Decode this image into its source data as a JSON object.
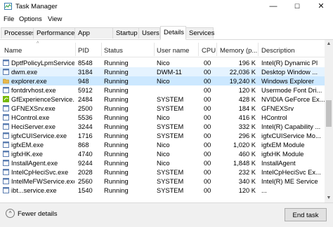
{
  "window": {
    "title": "Task Manager",
    "controls": {
      "minimize": "—",
      "maximize": "☐",
      "close": "✕"
    }
  },
  "menu": [
    "File",
    "Options",
    "View"
  ],
  "tabs": [
    "Processes",
    "Performance",
    "App history",
    "Startup",
    "Users",
    "Details",
    "Services"
  ],
  "active_tab": "Details",
  "columns": {
    "name": "Name",
    "pid": "PID",
    "status": "Status",
    "user": "User name",
    "cpu": "CPU",
    "memory": "Memory (p...",
    "description": "Description"
  },
  "rows": [
    {
      "name": "DptfPolicyLpmService...",
      "pid": "8548",
      "status": "Running",
      "user": "Nico",
      "cpu": "00",
      "memory": "196 K",
      "description": "Intel(R) Dynamic Pl",
      "icon": "app-icon",
      "color": "#5b7db1"
    },
    {
      "name": "dwm.exe",
      "pid": "3184",
      "status": "Running",
      "user": "DWM-11",
      "cpu": "00",
      "memory": "22,036 K",
      "description": "Desktop Window ...",
      "icon": "app-icon",
      "color": "#5b7db1"
    },
    {
      "name": "explorer.exe",
      "pid": "948",
      "status": "Running",
      "user": "Nico",
      "cpu": "00",
      "memory": "19,240 K",
      "description": "Windows Explorer",
      "icon": "folder-icon",
      "color": "#e8b84a"
    },
    {
      "name": "fontdrvhost.exe",
      "pid": "5912",
      "status": "Running",
      "user": "",
      "cpu": "00",
      "memory": "120 K",
      "description": "Usermode Font Dri...",
      "icon": "app-icon",
      "color": "#5b7db1"
    },
    {
      "name": "GfExperienceService....",
      "pid": "2484",
      "status": "Running",
      "user": "SYSTEM",
      "cpu": "00",
      "memory": "428 K",
      "description": "NVIDIA GeForce Ex...",
      "icon": "nvidia-icon",
      "color": "#76b900"
    },
    {
      "name": "GFNEXSrv.exe",
      "pid": "2500",
      "status": "Running",
      "user": "SYSTEM",
      "cpu": "00",
      "memory": "184 K",
      "description": "GFNEXSrv",
      "icon": "app-icon",
      "color": "#5b7db1"
    },
    {
      "name": "HControl.exe",
      "pid": "5536",
      "status": "Running",
      "user": "Nico",
      "cpu": "00",
      "memory": "416 K",
      "description": "HControl",
      "icon": "app-icon",
      "color": "#5b7db1"
    },
    {
      "name": "HeciServer.exe",
      "pid": "3244",
      "status": "Running",
      "user": "SYSTEM",
      "cpu": "00",
      "memory": "332 K",
      "description": "Intel(R) Capability ...",
      "icon": "app-icon",
      "color": "#5b7db1"
    },
    {
      "name": "igfxCUIService.exe",
      "pid": "1716",
      "status": "Running",
      "user": "SYSTEM",
      "cpu": "00",
      "memory": "296 K",
      "description": "igfxCUIService Mo...",
      "icon": "app-icon",
      "color": "#5b7db1"
    },
    {
      "name": "igfxEM.exe",
      "pid": "868",
      "status": "Running",
      "user": "Nico",
      "cpu": "00",
      "memory": "1,020 K",
      "description": "igfxEM Module",
      "icon": "app-icon",
      "color": "#5b7db1"
    },
    {
      "name": "igfxHK.exe",
      "pid": "4740",
      "status": "Running",
      "user": "Nico",
      "cpu": "00",
      "memory": "460 K",
      "description": "igfxHK Module",
      "icon": "app-icon",
      "color": "#5b7db1"
    },
    {
      "name": "InstallAgent.exe",
      "pid": "9244",
      "status": "Running",
      "user": "Nico",
      "cpu": "00",
      "memory": "1,848 K",
      "description": "InstallAgent",
      "icon": "app-icon",
      "color": "#5b7db1"
    },
    {
      "name": "IntelCpHeciSvc.exe",
      "pid": "2028",
      "status": "Running",
      "user": "SYSTEM",
      "cpu": "00",
      "memory": "232 K",
      "description": "IntelCpHeciSvc Ex...",
      "icon": "app-icon",
      "color": "#5b7db1"
    },
    {
      "name": "IntelMeFWService.exe",
      "pid": "2560",
      "status": "Running",
      "user": "SYSTEM",
      "cpu": "00",
      "memory": "340 K",
      "description": "Intel(R) ME Service",
      "icon": "app-icon",
      "color": "#5b7db1"
    },
    {
      "name": "ibt...service.exe",
      "pid": "1540",
      "status": "Running",
      "user": "SYSTEM",
      "cpu": "00",
      "memory": "120 K",
      "description": "...",
      "icon": "app-icon",
      "color": "#5b7db1"
    }
  ],
  "selected_row": 2,
  "hover_row": 1,
  "footer": {
    "fewer_details": "Fewer details",
    "fewer_icon": "^",
    "end_task": "End task"
  },
  "scrollbar": {
    "up": "▲",
    "down": "▼"
  },
  "colors": {
    "selection": "#cce8ff",
    "hover": "#e5f3ff",
    "accent": "#0078d7"
  }
}
